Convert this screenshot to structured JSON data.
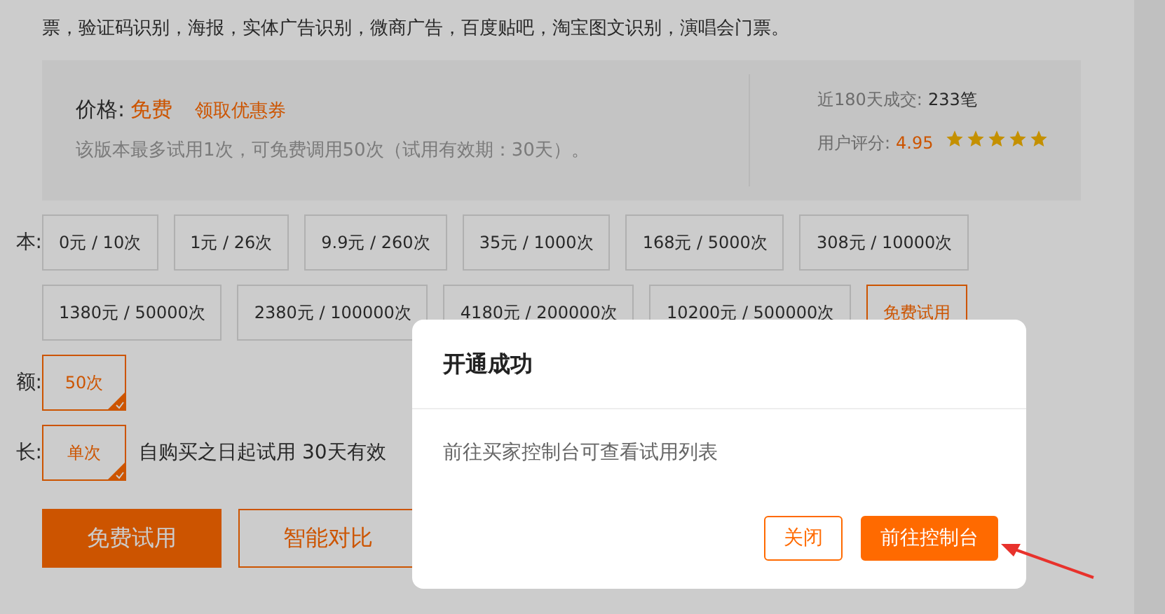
{
  "intro_text": "票，验证码识别，海报，实体广告识别，微商广告，百度贴吧，淘宝图文识别，演唱会门票。",
  "price": {
    "label": "价格:",
    "value": "免费",
    "coupon": "领取优惠券",
    "note": "该版本最多试用1次，可免费调用50次（试用有效期：30天）。"
  },
  "stats": {
    "deals_label": "近180天成交:",
    "deals_value": "233笔",
    "rating_label": "用户评分:",
    "rating_value": "4.95",
    "stars": 5
  },
  "options": [
    {
      "label": "本:",
      "items": [
        {
          "text": "0元 / 10次",
          "selected": false
        },
        {
          "text": "1元 / 26次",
          "selected": false
        },
        {
          "text": "9.9元 / 260次",
          "selected": false
        },
        {
          "text": "35元 / 1000次",
          "selected": false
        },
        {
          "text": "168元 / 5000次",
          "selected": false
        },
        {
          "text": "308元 / 10000次",
          "selected": false
        },
        {
          "text": "1380元 / 50000次",
          "selected": false
        },
        {
          "text": "2380元 / 100000次",
          "selected": false
        },
        {
          "text": "4180元 / 200000次",
          "selected": false
        },
        {
          "text": "10200元 / 500000次",
          "selected": false
        },
        {
          "text": "免费试用",
          "selected": true
        }
      ]
    },
    {
      "label": "额:",
      "items": [
        {
          "text": "50次",
          "selected": true
        }
      ]
    },
    {
      "label": "长:",
      "items": [
        {
          "text": "单次",
          "selected": true
        }
      ],
      "note": "自购买之日起试用 30天有效"
    }
  ],
  "actions": [
    {
      "text": "免费试用",
      "kind": "primary"
    },
    {
      "text": "智能对比",
      "kind": "secondary"
    }
  ],
  "modal": {
    "title": "开通成功",
    "body": "前往买家控制台可查看试用列表",
    "buttons": [
      {
        "text": "关闭",
        "kind": "secondary"
      },
      {
        "text": "前往控制台",
        "kind": "primary"
      }
    ]
  }
}
